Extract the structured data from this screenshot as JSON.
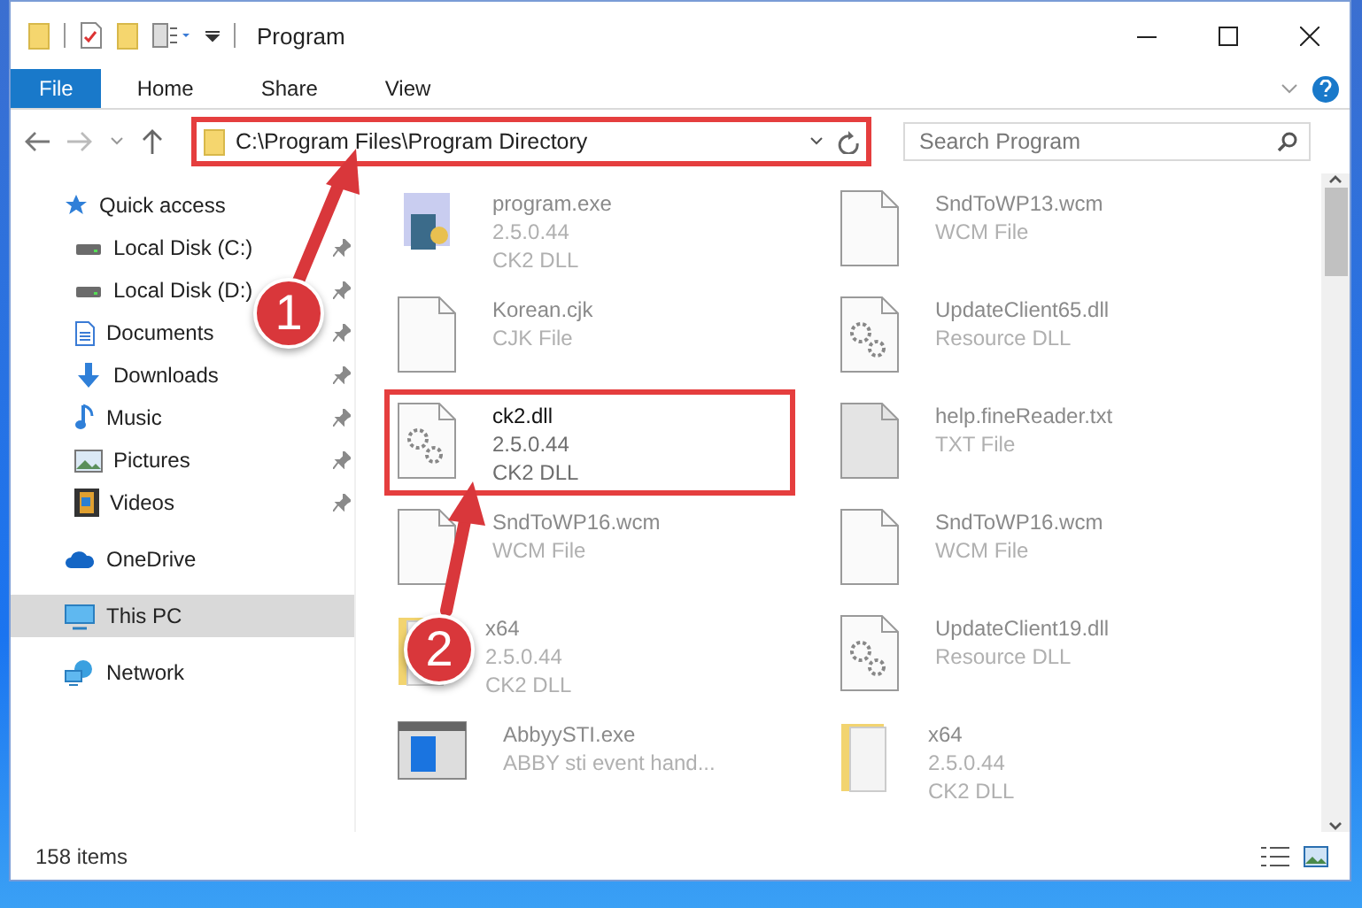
{
  "window": {
    "title": "Program"
  },
  "ribbon_tabs": [
    {
      "label": "File",
      "selected": true
    },
    {
      "label": "Home",
      "selected": false
    },
    {
      "label": "Share",
      "selected": false
    },
    {
      "label": "View",
      "selected": false
    }
  ],
  "address": {
    "path": "C:\\Program Files\\Program Directory",
    "highlighted": true
  },
  "search": {
    "placeholder": "Search Program"
  },
  "sidebar": {
    "items": [
      {
        "label": "Quick access",
        "kind": "star",
        "selected": false,
        "children": [
          {
            "label": "Local Disk (C:)",
            "kind": "drive",
            "pinned": true,
            "selected": false
          },
          {
            "label": "Local Disk (D:)",
            "kind": "drive",
            "pinned": true,
            "selected": false
          },
          {
            "label": "Documents",
            "kind": "document",
            "pinned": true,
            "selected": false
          },
          {
            "label": "Downloads",
            "kind": "download",
            "pinned": true,
            "selected": false
          },
          {
            "label": "Music",
            "kind": "music",
            "pinned": true,
            "selected": false
          },
          {
            "label": "Pictures",
            "kind": "picture",
            "pinned": true,
            "selected": false
          },
          {
            "label": "Videos",
            "kind": "video",
            "pinned": true,
            "selected": false
          }
        ]
      },
      {
        "label": "OneDrive",
        "kind": "cloud",
        "selected": false
      },
      {
        "label": "This PC",
        "kind": "pc",
        "selected": true
      },
      {
        "label": "Network",
        "kind": "network",
        "selected": false
      }
    ]
  },
  "files": [
    {
      "name": "program.exe",
      "details": [
        "2.5.0.44",
        "CK2 DLL"
      ],
      "kind": "exe",
      "blurred": true,
      "highlighted": false
    },
    {
      "name": "SndToWP13.wcm",
      "details": [
        "WCM File"
      ],
      "kind": "blank",
      "blurred": true,
      "highlighted": false
    },
    {
      "name": "Korean.cjk",
      "details": [
        "CJK File"
      ],
      "kind": "blank",
      "blurred": true,
      "highlighted": false
    },
    {
      "name": "UpdateClient65.dll",
      "details": [
        "Resource DLL"
      ],
      "kind": "gear",
      "blurred": true,
      "highlighted": false
    },
    {
      "name": "ck2.dll",
      "details": [
        "2.5.0.44",
        "CK2 DLL"
      ],
      "kind": "gear",
      "blurred": false,
      "highlighted": true
    },
    {
      "name": "help.fineReader.txt",
      "details": [
        "TXT File"
      ],
      "kind": "text",
      "blurred": true,
      "highlighted": false
    },
    {
      "name": "SndToWP16.wcm",
      "details": [
        "WCM File"
      ],
      "kind": "blank",
      "blurred": true,
      "highlighted": false
    },
    {
      "name": "SndToWP16.wcm",
      "details": [
        "WCM File"
      ],
      "kind": "blank",
      "blurred": true,
      "highlighted": false
    },
    {
      "name": "x64",
      "details": [
        "2.5.0.44",
        "CK2 DLL"
      ],
      "kind": "folder",
      "blurred": true,
      "highlighted": false
    },
    {
      "name": "UpdateClient19.dll",
      "details": [
        "Resource DLL"
      ],
      "kind": "gear",
      "blurred": true,
      "highlighted": false
    },
    {
      "name": "AbbyySTI.exe",
      "details": [
        "ABBY sti event hand..."
      ],
      "kind": "app",
      "blurred": true,
      "highlighted": false
    },
    {
      "name": "x64",
      "details": [
        "2.5.0.44",
        "CK2 DLL"
      ],
      "kind": "folder",
      "blurred": true,
      "highlighted": false
    }
  ],
  "status_bar": {
    "count": "158 items"
  },
  "callouts": [
    {
      "number": "1"
    },
    {
      "number": "2"
    }
  ]
}
